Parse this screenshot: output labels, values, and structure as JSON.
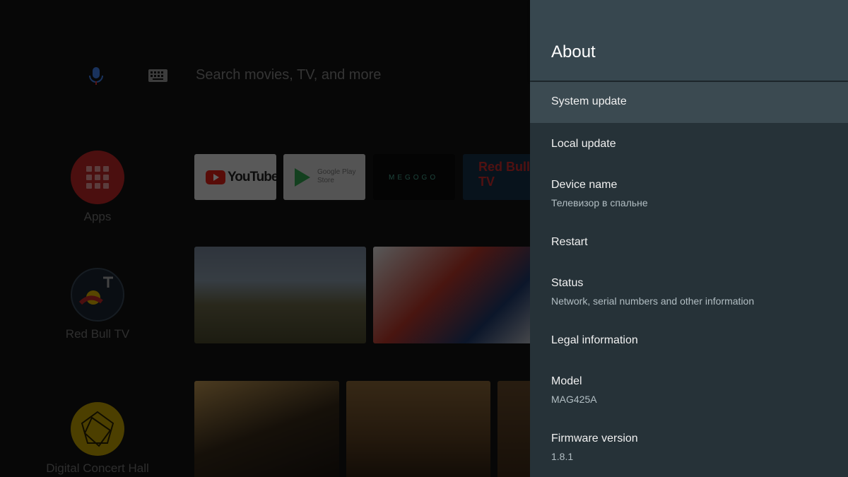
{
  "search": {
    "placeholder": "Search movies, TV, and more"
  },
  "sidebar": {
    "items": [
      {
        "label": "Apps",
        "icon": "apps-grid-icon",
        "color": "#c62828"
      },
      {
        "label": "Red Bull TV",
        "icon": "red-bull-tv-logo"
      },
      {
        "label": "Digital Concert Hall",
        "icon": "digital-concert-hall-logo",
        "color": "#c9a600"
      }
    ]
  },
  "app_tiles": {
    "youtube": "YouTube",
    "google_play": "Google Play Store",
    "megogo": "MEGOGO",
    "red_bull_tv": "Red Bull TV"
  },
  "settings": {
    "title": "About",
    "items": [
      {
        "title": "System update",
        "selected": true
      },
      {
        "title": "Local update"
      },
      {
        "title": "Device name",
        "subtitle": "Телевизор в спальне"
      },
      {
        "title": "Restart"
      },
      {
        "title": "Status",
        "subtitle": "Network, serial numbers and other information"
      },
      {
        "title": "Legal information"
      },
      {
        "title": "Model",
        "subtitle": "MAG425A"
      },
      {
        "title": "Firmware version",
        "subtitle": "1.8.1"
      }
    ],
    "colors": {
      "panel_bg": "#263238",
      "header_bg": "#37474f",
      "selected_bg": "#3b4a51"
    }
  }
}
